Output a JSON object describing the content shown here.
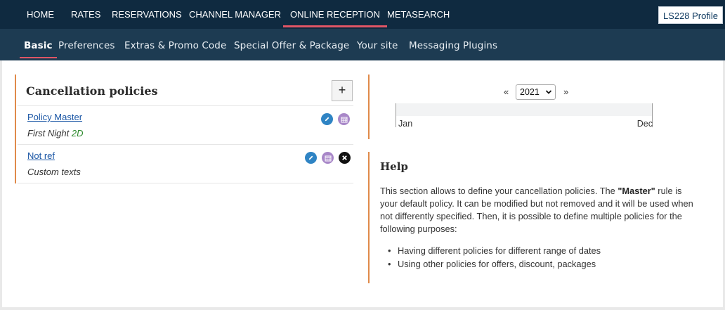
{
  "topnav": {
    "items": [
      {
        "label": "HOME"
      },
      {
        "label": "RATES"
      },
      {
        "label": "RESERVATIONS"
      },
      {
        "label": "CHANNEL MANAGER"
      },
      {
        "label": "ONLINE RECEPTION"
      },
      {
        "label": "METASEARCH"
      }
    ],
    "active": "ONLINE RECEPTION",
    "profile_label": "LS228 Profile"
  },
  "subnav": {
    "items": [
      {
        "label": "Basic"
      },
      {
        "label": "Preferences"
      },
      {
        "label": "Extras & Promo Code"
      },
      {
        "label": "Special Offer & Package"
      },
      {
        "label": "Your site"
      },
      {
        "label": "Messaging Plugins"
      }
    ],
    "active": "Basic"
  },
  "policies_panel": {
    "title": "Cancellation policies",
    "add_label": "+",
    "policies": [
      {
        "name": "Policy Master",
        "subtitle": "First Night",
        "tag": "2D"
      },
      {
        "name": "Not ref",
        "subtitle": "Custom texts",
        "tag": ""
      }
    ]
  },
  "calendar": {
    "prev": "«",
    "year": "2021",
    "next": "»",
    "start_label": "Jan",
    "end_label": "Dec"
  },
  "help": {
    "title": "Help",
    "text_before": "This section allows to define your cancellation policies. The ",
    "text_bold": "\"Master\"",
    "text_after": " rule is your default policy. It can be modified but not removed and it will be used when not differently specified. Then, it is possible to define multiple policies for the following purposes:",
    "bullets": [
      "Having different policies for different range of dates",
      "Using other policies for offers, discount, packages"
    ]
  },
  "colors": {
    "topnav_bg": "#0f2a40",
    "subnav_bg": "#1d3b52",
    "accent_underline": "#e05565",
    "panel_border": "#e08a4a",
    "link": "#1a56a5",
    "tag_green": "#2c8a2c",
    "edit_icon": "#2f84c4",
    "calendar_icon": "#a887c8"
  }
}
